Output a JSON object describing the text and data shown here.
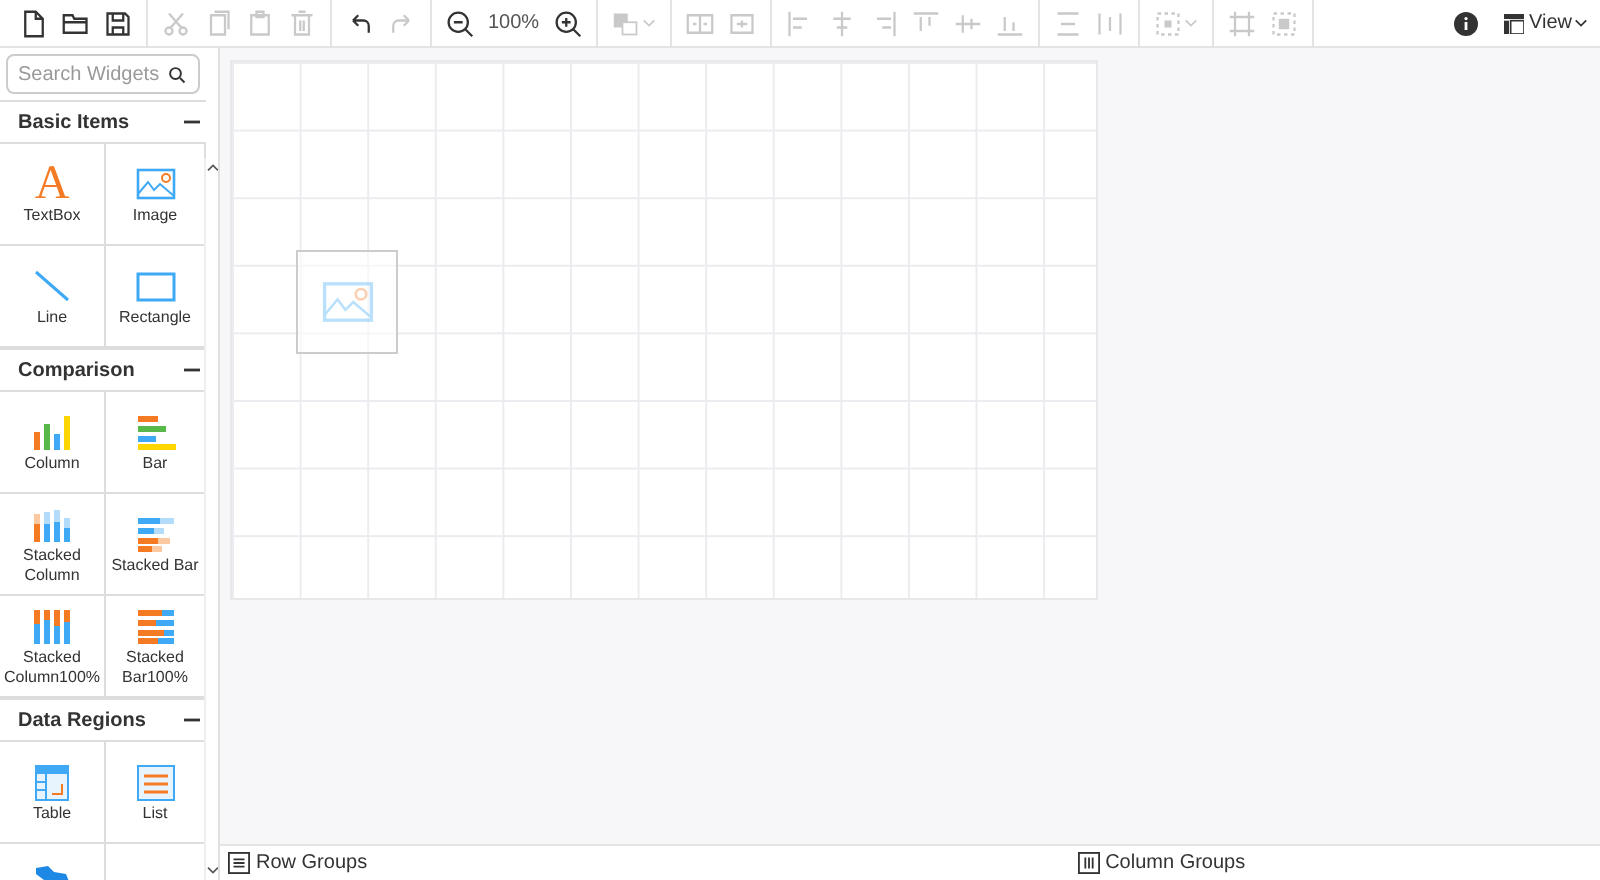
{
  "toolbar": {
    "groups": [
      {
        "items": [
          {
            "kind": "new",
            "disabled": false
          },
          {
            "kind": "open",
            "disabled": false
          },
          {
            "kind": "save",
            "disabled": false
          }
        ]
      },
      {
        "items": [
          {
            "kind": "cut",
            "disabled": true
          },
          {
            "kind": "copy",
            "disabled": true
          },
          {
            "kind": "paste",
            "disabled": true
          },
          {
            "kind": "delete",
            "disabled": true
          }
        ]
      },
      {
        "items": [
          {
            "kind": "undo",
            "disabled": false
          },
          {
            "kind": "redo",
            "disabled": true
          }
        ]
      },
      {
        "items": [
          {
            "kind": "zoom-out",
            "disabled": false
          },
          {
            "kind": "zoom-level",
            "text": "100%",
            "disabled": false
          },
          {
            "kind": "zoom-in",
            "disabled": false
          }
        ]
      },
      {
        "items": [
          {
            "kind": "order",
            "disabled": true,
            "dropdown": true
          }
        ]
      },
      {
        "items": [
          {
            "kind": "split-v",
            "disabled": true
          },
          {
            "kind": "split-h",
            "disabled": true
          }
        ]
      },
      {
        "items": [
          {
            "kind": "align-left",
            "disabled": true
          },
          {
            "kind": "align-center",
            "disabled": true
          },
          {
            "kind": "align-right",
            "disabled": true
          },
          {
            "kind": "align-top",
            "disabled": true
          },
          {
            "kind": "align-middle",
            "disabled": true
          },
          {
            "kind": "align-bottom",
            "disabled": true
          }
        ]
      },
      {
        "items": [
          {
            "kind": "distribute-v",
            "disabled": true
          },
          {
            "kind": "distribute-h",
            "disabled": true
          }
        ]
      },
      {
        "items": [
          {
            "kind": "select",
            "disabled": true,
            "dropdown": true
          }
        ]
      },
      {
        "items": [
          {
            "kind": "size-fit",
            "disabled": true
          },
          {
            "kind": "size-center",
            "disabled": true
          }
        ]
      }
    ],
    "view": {
      "label": "View"
    }
  },
  "sidebar": {
    "search": {
      "placeholder": "Search Widgets"
    },
    "sections": [
      {
        "title": "Basic Items",
        "expanded": true,
        "items": [
          {
            "kind": "textbox",
            "glyph": "A",
            "label": "TextBox"
          },
          {
            "kind": "image",
            "label": "Image"
          },
          {
            "kind": "line",
            "label": "Line"
          },
          {
            "kind": "rectangle",
            "label": "Rectangle"
          }
        ]
      },
      {
        "title": "Comparison",
        "expanded": true,
        "items": [
          {
            "kind": "column",
            "label": "Column"
          },
          {
            "kind": "bar",
            "label": "Bar"
          },
          {
            "kind": "stacked-column",
            "label": "Stacked Column"
          },
          {
            "kind": "stacked-bar",
            "label": "Stacked Bar"
          },
          {
            "kind": "stacked-column-100",
            "label": "Stacked Column100%"
          },
          {
            "kind": "stacked-bar-100",
            "label": "Stacked Bar100%"
          }
        ]
      },
      {
        "title": "Data Regions",
        "expanded": true,
        "items": [
          {
            "kind": "table",
            "label": "Table"
          },
          {
            "kind": "list",
            "label": "List"
          },
          {
            "kind": "map"
          },
          {
            "kind": "blank"
          }
        ]
      }
    ]
  },
  "canvas": {
    "items": [
      {
        "kind": "image"
      }
    ]
  },
  "footer": {
    "row_groups": "Row Groups",
    "column_groups": "Column Groups"
  }
}
